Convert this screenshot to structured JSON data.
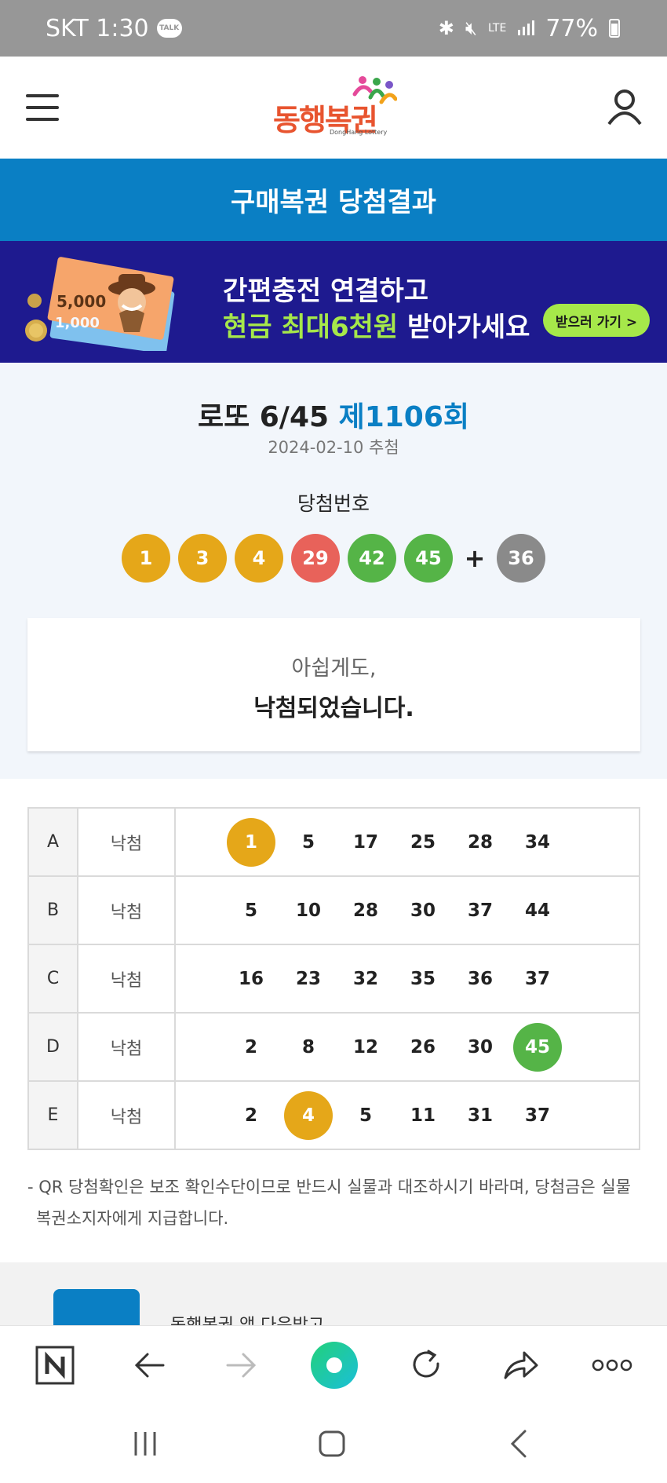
{
  "status_bar": {
    "carrier_time": "SKT 1:30",
    "talk_badge": "TALK",
    "network": "LTE",
    "battery": "77%"
  },
  "header": {
    "logo_text": "동행복권",
    "logo_subtext": "DongHang Lottery"
  },
  "title_band": "구매복권 당첨결과",
  "promo": {
    "line1": "간편충전 연결하고",
    "line2_highlight": "현금 최대6천원",
    "line2_rest": " 받아가세요",
    "button": "받으러 가기 >",
    "bill_front": "5,000",
    "bill_back": "1,000"
  },
  "draw": {
    "game": "로또 6/45 ",
    "round": "제1106회",
    "date": "2024-02-10 추첨",
    "winning_label": "당첨번호",
    "numbers": [
      "1",
      "3",
      "4",
      "29",
      "42",
      "45"
    ],
    "plus": "+",
    "bonus": "36"
  },
  "result_message": {
    "line1": "아쉽게도,",
    "line2": "낙첨되었습니다."
  },
  "games": [
    {
      "letter": "A",
      "result": "낙첨",
      "numbers": [
        "1",
        "5",
        "17",
        "25",
        "28",
        "34"
      ],
      "matched": [
        "1"
      ]
    },
    {
      "letter": "B",
      "result": "낙첨",
      "numbers": [
        "5",
        "10",
        "28",
        "30",
        "37",
        "44"
      ],
      "matched": []
    },
    {
      "letter": "C",
      "result": "낙첨",
      "numbers": [
        "16",
        "23",
        "32",
        "35",
        "36",
        "37"
      ],
      "matched": []
    },
    {
      "letter": "D",
      "result": "낙첨",
      "numbers": [
        "2",
        "8",
        "12",
        "26",
        "30",
        "45"
      ],
      "matched": [
        "45"
      ]
    },
    {
      "letter": "E",
      "result": "낙첨",
      "numbers": [
        "2",
        "4",
        "5",
        "11",
        "31",
        "37"
      ],
      "matched": [
        "4"
      ]
    }
  ],
  "notice": "- QR 당첨확인은 보조 확인수단이므로 반드시 실물과 대조하시기 바라며, 당첨금은 실물 복권소지자에게 지급합니다.",
  "app_strip": {
    "text": "동행복권 앱 다운받고"
  },
  "ball_colors": {
    "yellow": "#e5a719",
    "blue": "#3a8fd9",
    "red": "#e8625a",
    "gray": "#8a8a8a",
    "green": "#55b447"
  },
  "colors": {
    "primary_blue": "#0a7fc4",
    "promo_navy": "#1e1a8f",
    "promo_green": "#a6e84a"
  }
}
